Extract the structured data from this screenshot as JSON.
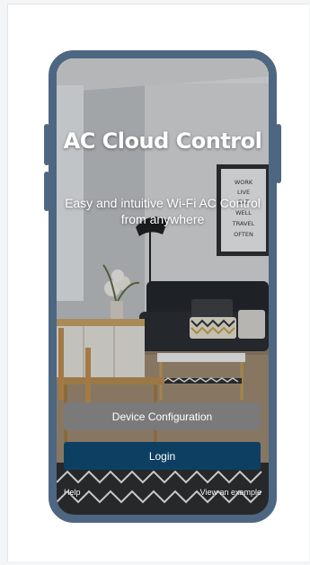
{
  "app": {
    "title": "AC Cloud Control",
    "subtitle": "Easy and intuitive Wi-Fi AC Control from anywhere"
  },
  "buttons": {
    "device_configuration": "Device Configuration",
    "login": "Login"
  },
  "links": {
    "help": "Help",
    "view_example": "View an example"
  },
  "poster": {
    "lines": [
      "WORK",
      "LIVE",
      "EAT",
      "WELL",
      "TRAVEL",
      "OFTEN"
    ]
  },
  "colors": {
    "phone_frame": "#4d6783",
    "config_button": "#7a7a7b",
    "login_button": "#0d3f63"
  }
}
